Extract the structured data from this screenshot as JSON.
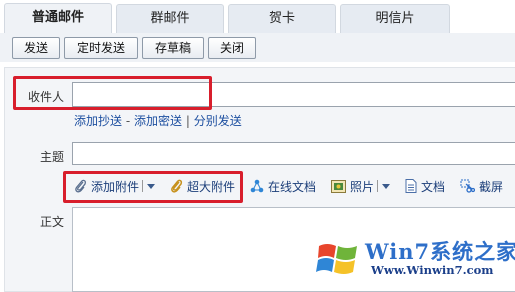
{
  "tabs": [
    {
      "label": "普通邮件",
      "active": true
    },
    {
      "label": "群邮件",
      "active": false
    },
    {
      "label": "贺卡",
      "active": false
    },
    {
      "label": "明信片",
      "active": false
    }
  ],
  "toolbar": {
    "send": "发送",
    "scheduled_send": "定时发送",
    "save_draft": "存草稿",
    "close": "关闭"
  },
  "compose": {
    "recipient_label": "收件人",
    "recipient_value": "",
    "add_cc": "添加抄送",
    "dash": "-",
    "add_bcc": "添加密送",
    "pipe": "|",
    "separate_send": "分别发送",
    "subject_label": "主题",
    "subject_value": "",
    "body_label": "正文"
  },
  "attachments": {
    "add_attachment": "添加附件",
    "large_attachment": "超大附件",
    "online_doc": "在线文档",
    "photo": "照片",
    "document": "文档",
    "screenshot": "截屏"
  },
  "watermark": {
    "title": "Win7系统之家",
    "url": "Www.Winwin7.com"
  },
  "colors": {
    "highlight_box": "#d81e2c",
    "link": "#1d4fa0",
    "tab_bg": "#e6ebf2",
    "toolbar_bg": "#eff2f6"
  },
  "icons": {
    "add_attachment": "paperclip-icon",
    "large_attachment": "paperclip-gold-icon",
    "online_doc": "share-nodes-icon",
    "photo": "picture-icon",
    "document": "document-icon",
    "screenshot": "scissors-icon",
    "watermark_logo": "windows-logo-icon"
  }
}
